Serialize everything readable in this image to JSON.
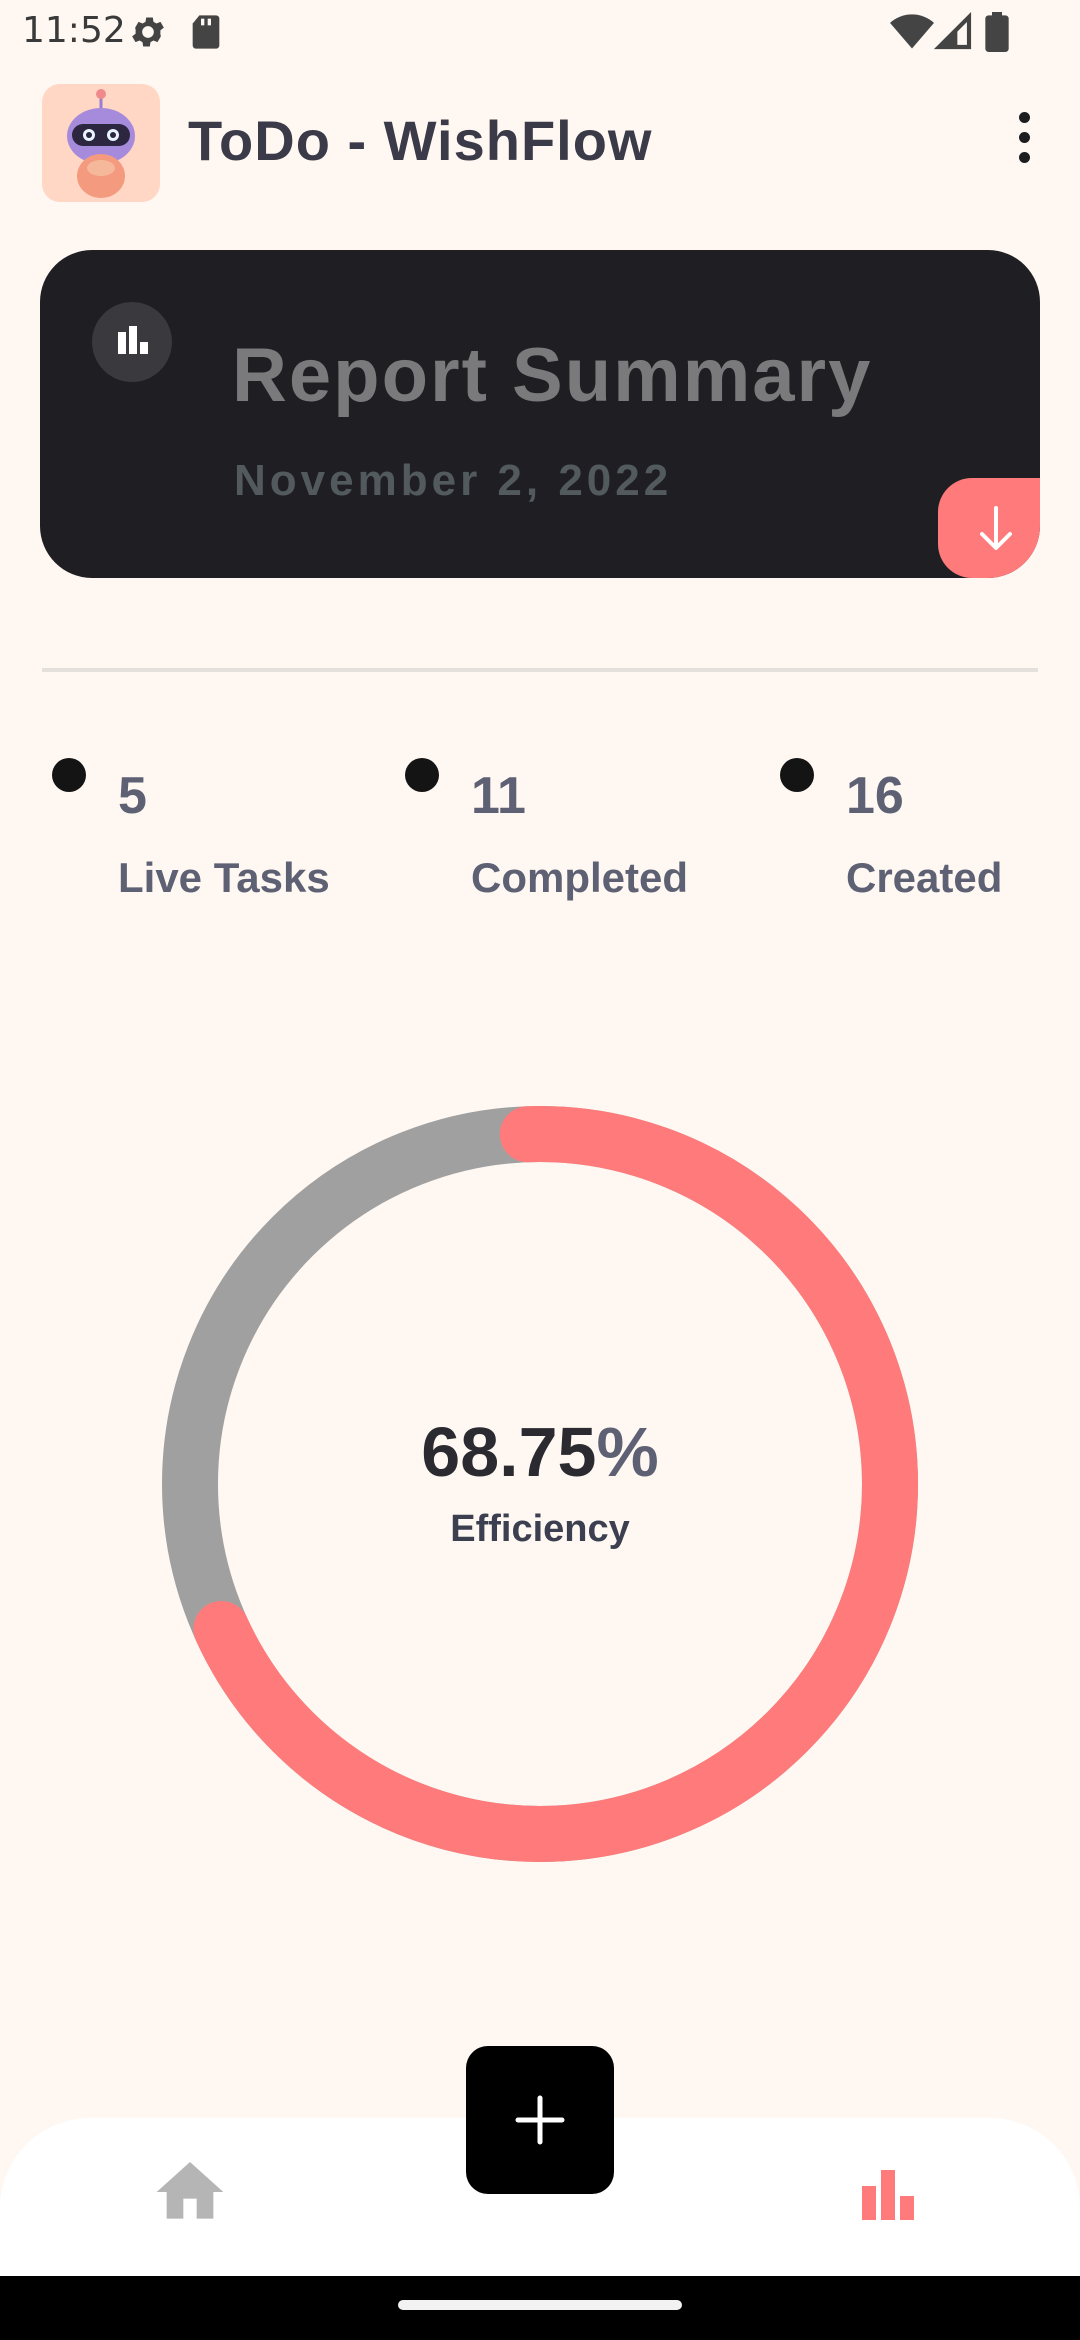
{
  "status_bar": {
    "time": "11:52",
    "icons": [
      "settings-icon",
      "sd-card-icon",
      "wifi-icon",
      "signal-icon",
      "battery-icon"
    ]
  },
  "app_bar": {
    "title": "ToDo - WishFlow",
    "logo_icon": "robot-mascot-icon",
    "menu_icon": "more-vert-icon"
  },
  "report_card": {
    "title": "Report Summary",
    "date": "November 2, 2022",
    "chart_icon": "bar-chart-icon",
    "download_icon": "arrow-down-icon"
  },
  "stats": [
    {
      "value": "5",
      "label": "Live Tasks"
    },
    {
      "value": "11",
      "label": "Completed"
    },
    {
      "value": "16",
      "label": "Created"
    }
  ],
  "efficiency": {
    "value": "68.75",
    "unit": "%",
    "label": "Efficiency",
    "fraction": 0.6875
  },
  "bottom_nav": {
    "home_icon": "home-icon",
    "add_icon": "plus-icon",
    "reports_icon": "bar-chart-icon"
  },
  "colors": {
    "background": "#FFF8F2",
    "card": "#1F1F23",
    "accent": "#FF7A7A",
    "track": "#A0A0A0",
    "text_muted": "#5D6173"
  }
}
